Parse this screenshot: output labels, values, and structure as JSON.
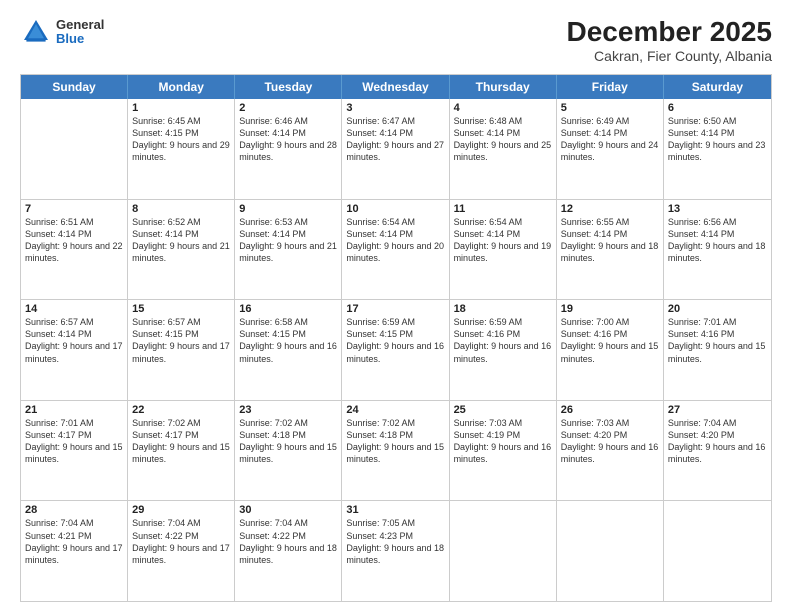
{
  "header": {
    "logo": {
      "general": "General",
      "blue": "Blue"
    },
    "title": "December 2025",
    "location": "Cakran, Fier County, Albania"
  },
  "weekdays": [
    "Sunday",
    "Monday",
    "Tuesday",
    "Wednesday",
    "Thursday",
    "Friday",
    "Saturday"
  ],
  "weeks": [
    [
      {
        "day": "",
        "info": ""
      },
      {
        "day": "1",
        "info": "Sunrise: 6:45 AM\nSunset: 4:15 PM\nDaylight: 9 hours\nand 29 minutes."
      },
      {
        "day": "2",
        "info": "Sunrise: 6:46 AM\nSunset: 4:14 PM\nDaylight: 9 hours\nand 28 minutes."
      },
      {
        "day": "3",
        "info": "Sunrise: 6:47 AM\nSunset: 4:14 PM\nDaylight: 9 hours\nand 27 minutes."
      },
      {
        "day": "4",
        "info": "Sunrise: 6:48 AM\nSunset: 4:14 PM\nDaylight: 9 hours\nand 25 minutes."
      },
      {
        "day": "5",
        "info": "Sunrise: 6:49 AM\nSunset: 4:14 PM\nDaylight: 9 hours\nand 24 minutes."
      },
      {
        "day": "6",
        "info": "Sunrise: 6:50 AM\nSunset: 4:14 PM\nDaylight: 9 hours\nand 23 minutes."
      }
    ],
    [
      {
        "day": "7",
        "info": "Sunrise: 6:51 AM\nSunset: 4:14 PM\nDaylight: 9 hours\nand 22 minutes."
      },
      {
        "day": "8",
        "info": "Sunrise: 6:52 AM\nSunset: 4:14 PM\nDaylight: 9 hours\nand 21 minutes."
      },
      {
        "day": "9",
        "info": "Sunrise: 6:53 AM\nSunset: 4:14 PM\nDaylight: 9 hours\nand 21 minutes."
      },
      {
        "day": "10",
        "info": "Sunrise: 6:54 AM\nSunset: 4:14 PM\nDaylight: 9 hours\nand 20 minutes."
      },
      {
        "day": "11",
        "info": "Sunrise: 6:54 AM\nSunset: 4:14 PM\nDaylight: 9 hours\nand 19 minutes."
      },
      {
        "day": "12",
        "info": "Sunrise: 6:55 AM\nSunset: 4:14 PM\nDaylight: 9 hours\nand 18 minutes."
      },
      {
        "day": "13",
        "info": "Sunrise: 6:56 AM\nSunset: 4:14 PM\nDaylight: 9 hours\nand 18 minutes."
      }
    ],
    [
      {
        "day": "14",
        "info": "Sunrise: 6:57 AM\nSunset: 4:14 PM\nDaylight: 9 hours\nand 17 minutes."
      },
      {
        "day": "15",
        "info": "Sunrise: 6:57 AM\nSunset: 4:15 PM\nDaylight: 9 hours\nand 17 minutes."
      },
      {
        "day": "16",
        "info": "Sunrise: 6:58 AM\nSunset: 4:15 PM\nDaylight: 9 hours\nand 16 minutes."
      },
      {
        "day": "17",
        "info": "Sunrise: 6:59 AM\nSunset: 4:15 PM\nDaylight: 9 hours\nand 16 minutes."
      },
      {
        "day": "18",
        "info": "Sunrise: 6:59 AM\nSunset: 4:16 PM\nDaylight: 9 hours\nand 16 minutes."
      },
      {
        "day": "19",
        "info": "Sunrise: 7:00 AM\nSunset: 4:16 PM\nDaylight: 9 hours\nand 15 minutes."
      },
      {
        "day": "20",
        "info": "Sunrise: 7:01 AM\nSunset: 4:16 PM\nDaylight: 9 hours\nand 15 minutes."
      }
    ],
    [
      {
        "day": "21",
        "info": "Sunrise: 7:01 AM\nSunset: 4:17 PM\nDaylight: 9 hours\nand 15 minutes."
      },
      {
        "day": "22",
        "info": "Sunrise: 7:02 AM\nSunset: 4:17 PM\nDaylight: 9 hours\nand 15 minutes."
      },
      {
        "day": "23",
        "info": "Sunrise: 7:02 AM\nSunset: 4:18 PM\nDaylight: 9 hours\nand 15 minutes."
      },
      {
        "day": "24",
        "info": "Sunrise: 7:02 AM\nSunset: 4:18 PM\nDaylight: 9 hours\nand 15 minutes."
      },
      {
        "day": "25",
        "info": "Sunrise: 7:03 AM\nSunset: 4:19 PM\nDaylight: 9 hours\nand 16 minutes."
      },
      {
        "day": "26",
        "info": "Sunrise: 7:03 AM\nSunset: 4:20 PM\nDaylight: 9 hours\nand 16 minutes."
      },
      {
        "day": "27",
        "info": "Sunrise: 7:04 AM\nSunset: 4:20 PM\nDaylight: 9 hours\nand 16 minutes."
      }
    ],
    [
      {
        "day": "28",
        "info": "Sunrise: 7:04 AM\nSunset: 4:21 PM\nDaylight: 9 hours\nand 17 minutes."
      },
      {
        "day": "29",
        "info": "Sunrise: 7:04 AM\nSunset: 4:22 PM\nDaylight: 9 hours\nand 17 minutes."
      },
      {
        "day": "30",
        "info": "Sunrise: 7:04 AM\nSunset: 4:22 PM\nDaylight: 9 hours\nand 18 minutes."
      },
      {
        "day": "31",
        "info": "Sunrise: 7:05 AM\nSunset: 4:23 PM\nDaylight: 9 hours\nand 18 minutes."
      },
      {
        "day": "",
        "info": ""
      },
      {
        "day": "",
        "info": ""
      },
      {
        "day": "",
        "info": ""
      }
    ]
  ]
}
